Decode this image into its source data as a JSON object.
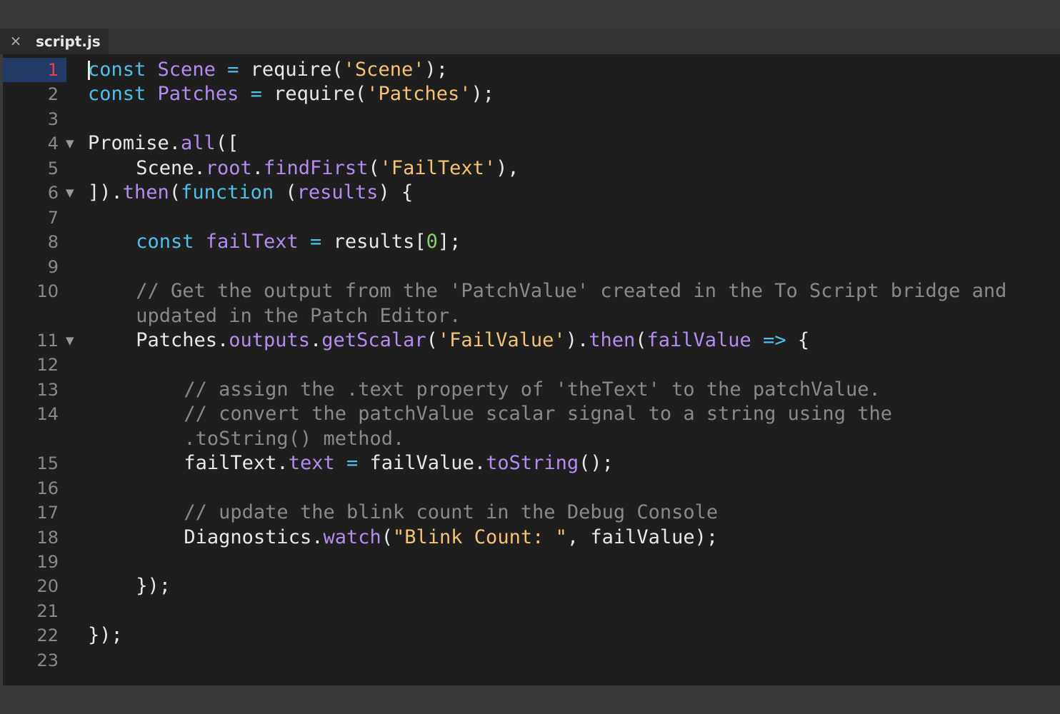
{
  "tab": {
    "close_symbol": "×",
    "title": "script.js"
  },
  "editor": {
    "active_line": 1,
    "lines": [
      {
        "n": "1",
        "fold": false,
        "indent": 0,
        "tokens": [
          [
            "kw",
            "const"
          ],
          [
            "plain",
            " "
          ],
          [
            "var",
            "Scene"
          ],
          [
            "plain",
            " "
          ],
          [
            "op",
            "="
          ],
          [
            "plain",
            " require("
          ],
          [
            "str",
            "'Scene'"
          ],
          [
            "plain",
            ");"
          ]
        ]
      },
      {
        "n": "2",
        "fold": false,
        "indent": 0,
        "tokens": [
          [
            "kw",
            "const"
          ],
          [
            "plain",
            " "
          ],
          [
            "var",
            "Patches"
          ],
          [
            "plain",
            " "
          ],
          [
            "op",
            "="
          ],
          [
            "plain",
            " require("
          ],
          [
            "str",
            "'Patches'"
          ],
          [
            "plain",
            ");"
          ]
        ]
      },
      {
        "n": "3",
        "fold": false,
        "indent": 0,
        "tokens": []
      },
      {
        "n": "4",
        "fold": true,
        "indent": 0,
        "tokens": [
          [
            "plain",
            "Promise."
          ],
          [
            "var",
            "all"
          ],
          [
            "plain",
            "(["
          ]
        ]
      },
      {
        "n": "5",
        "fold": false,
        "indent": 4,
        "tokens": [
          [
            "plain",
            "Scene."
          ],
          [
            "var",
            "root"
          ],
          [
            "plain",
            "."
          ],
          [
            "var",
            "findFirst"
          ],
          [
            "plain",
            "("
          ],
          [
            "str",
            "'FailText'"
          ],
          [
            "plain",
            "),"
          ]
        ]
      },
      {
        "n": "6",
        "fold": true,
        "indent": 0,
        "tokens": [
          [
            "plain",
            "])."
          ],
          [
            "var",
            "then"
          ],
          [
            "plain",
            "("
          ],
          [
            "kw",
            "function"
          ],
          [
            "plain",
            " ("
          ],
          [
            "var",
            "results"
          ],
          [
            "plain",
            ") {"
          ]
        ]
      },
      {
        "n": "7",
        "fold": false,
        "indent": 0,
        "tokens": []
      },
      {
        "n": "8",
        "fold": false,
        "indent": 4,
        "tokens": [
          [
            "kw",
            "const"
          ],
          [
            "plain",
            " "
          ],
          [
            "var",
            "failText"
          ],
          [
            "plain",
            " "
          ],
          [
            "op",
            "="
          ],
          [
            "plain",
            " results["
          ],
          [
            "num",
            "0"
          ],
          [
            "plain",
            "];"
          ]
        ]
      },
      {
        "n": "9",
        "fold": false,
        "indent": 0,
        "tokens": []
      },
      {
        "n": "10",
        "fold": false,
        "indent": 4,
        "tokens": [
          [
            "cmt",
            "// Get the output from the 'PatchValue' created in the To Script bridge and"
          ]
        ]
      },
      {
        "n": "",
        "fold": false,
        "indent": 4,
        "tokens": [
          [
            "cmt",
            "updated in the Patch Editor."
          ]
        ]
      },
      {
        "n": "11",
        "fold": true,
        "indent": 4,
        "tokens": [
          [
            "plain",
            "Patches."
          ],
          [
            "var",
            "outputs"
          ],
          [
            "plain",
            "."
          ],
          [
            "var",
            "getScalar"
          ],
          [
            "plain",
            "("
          ],
          [
            "str",
            "'FailValue'"
          ],
          [
            "plain",
            ")."
          ],
          [
            "var",
            "then"
          ],
          [
            "plain",
            "("
          ],
          [
            "var",
            "failValue"
          ],
          [
            "plain",
            " "
          ],
          [
            "op",
            "=>"
          ],
          [
            "plain",
            " {"
          ]
        ]
      },
      {
        "n": "12",
        "fold": false,
        "indent": 0,
        "tokens": []
      },
      {
        "n": "13",
        "fold": false,
        "indent": 8,
        "tokens": [
          [
            "cmt",
            "// assign the .text property of 'theText' to the patchValue."
          ]
        ]
      },
      {
        "n": "14",
        "fold": false,
        "indent": 8,
        "tokens": [
          [
            "cmt",
            "// convert the patchValue scalar signal to a string using the"
          ]
        ]
      },
      {
        "n": "",
        "fold": false,
        "indent": 8,
        "tokens": [
          [
            "cmt",
            ".toString() method."
          ]
        ]
      },
      {
        "n": "15",
        "fold": false,
        "indent": 8,
        "tokens": [
          [
            "plain",
            "failText."
          ],
          [
            "var",
            "text"
          ],
          [
            "plain",
            " "
          ],
          [
            "op",
            "="
          ],
          [
            "plain",
            " failValue."
          ],
          [
            "var",
            "toString"
          ],
          [
            "plain",
            "();"
          ]
        ]
      },
      {
        "n": "16",
        "fold": false,
        "indent": 0,
        "tokens": []
      },
      {
        "n": "17",
        "fold": false,
        "indent": 8,
        "tokens": [
          [
            "cmt",
            "// update the blink count in the Debug Console"
          ]
        ]
      },
      {
        "n": "18",
        "fold": false,
        "indent": 8,
        "tokens": [
          [
            "plain",
            "Diagnostics."
          ],
          [
            "var",
            "watch"
          ],
          [
            "plain",
            "("
          ],
          [
            "str",
            "\"Blink Count: \""
          ],
          [
            "plain",
            ", failValue);"
          ]
        ]
      },
      {
        "n": "19",
        "fold": false,
        "indent": 0,
        "tokens": []
      },
      {
        "n": "20",
        "fold": false,
        "indent": 4,
        "tokens": [
          [
            "plain",
            "});"
          ]
        ]
      },
      {
        "n": "21",
        "fold": false,
        "indent": 0,
        "tokens": []
      },
      {
        "n": "22",
        "fold": false,
        "indent": 0,
        "tokens": [
          [
            "plain",
            "});"
          ]
        ]
      },
      {
        "n": "23",
        "fold": false,
        "indent": 0,
        "tokens": []
      }
    ]
  },
  "colors": {
    "keyword": "#4fc1e9",
    "identifier": "#b58cf0",
    "string": "#f2c473",
    "number": "#8bcf6a",
    "comment": "#8a8a8a",
    "active_line_number": "#e84545",
    "active_gutter": "#233a66"
  }
}
